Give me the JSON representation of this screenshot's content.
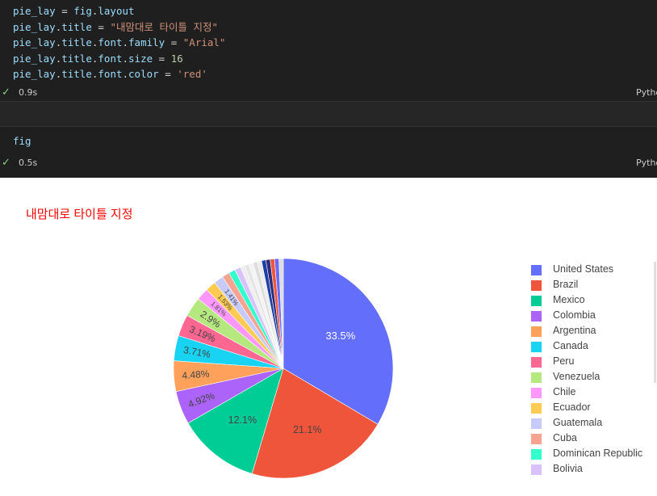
{
  "code_cell": {
    "lines": [
      [
        {
          "t": "pie_lay",
          "c": "v"
        },
        {
          "t": " = ",
          "c": "p"
        },
        {
          "t": "fig",
          "c": "v"
        },
        {
          "t": ".",
          "c": "p"
        },
        {
          "t": "layout",
          "c": "v"
        }
      ],
      [
        {
          "t": "pie_lay",
          "c": "v"
        },
        {
          "t": ".",
          "c": "p"
        },
        {
          "t": "title",
          "c": "v"
        },
        {
          "t": " = ",
          "c": "p"
        },
        {
          "t": "\"내맘대로 타이틀 지정\"",
          "c": "s"
        }
      ],
      [
        {
          "t": "pie_lay",
          "c": "v"
        },
        {
          "t": ".",
          "c": "p"
        },
        {
          "t": "title",
          "c": "v"
        },
        {
          "t": ".",
          "c": "p"
        },
        {
          "t": "font",
          "c": "v"
        },
        {
          "t": ".",
          "c": "p"
        },
        {
          "t": "family",
          "c": "v"
        },
        {
          "t": " = ",
          "c": "p"
        },
        {
          "t": "\"Arial\"",
          "c": "s"
        }
      ],
      [
        {
          "t": "pie_lay",
          "c": "v"
        },
        {
          "t": ".",
          "c": "p"
        },
        {
          "t": "title",
          "c": "v"
        },
        {
          "t": ".",
          "c": "p"
        },
        {
          "t": "font",
          "c": "v"
        },
        {
          "t": ".",
          "c": "p"
        },
        {
          "t": "size",
          "c": "v"
        },
        {
          "t": " = ",
          "c": "p"
        },
        {
          "t": "16",
          "c": "n"
        }
      ],
      [
        {
          "t": "pie_lay",
          "c": "v"
        },
        {
          "t": ".",
          "c": "p"
        },
        {
          "t": "title",
          "c": "v"
        },
        {
          "t": ".",
          "c": "p"
        },
        {
          "t": "font",
          "c": "v"
        },
        {
          "t": ".",
          "c": "p"
        },
        {
          "t": "color",
          "c": "v"
        },
        {
          "t": " = ",
          "c": "p"
        },
        {
          "t": "'red'",
          "c": "s"
        }
      ]
    ],
    "status_time": "0.9s",
    "language": "Python"
  },
  "fig_cell": {
    "code": "fig",
    "status_time": "0.5s",
    "language": "Python"
  },
  "output": {
    "title": "내맘대로 타이틀 지정"
  },
  "chart_data": {
    "type": "pie",
    "title": "내맘대로 타이틀 지정",
    "legend_position": "right",
    "categories": [
      "United States",
      "Brazil",
      "Mexico",
      "Colombia",
      "Argentina",
      "Canada",
      "Peru",
      "Venezuela",
      "Chile",
      "Ecuador",
      "Guatemala",
      "Cuba",
      "Dominican Republic",
      "Bolivia"
    ],
    "values": [
      33.5,
      21.1,
      12.1,
      4.92,
      4.48,
      3.71,
      3.19,
      2.9,
      1.81,
      1.53,
      1.41,
      1.1,
      0.98,
      0.9
    ],
    "labels": [
      "33.5%",
      "21.1%",
      "12.1%",
      "4.92%",
      "4.48%",
      "3.71%",
      "3.19%",
      "2.9%",
      "1.81%",
      "1.53%",
      "1.41%",
      "1.1%",
      "0.98%",
      "0.9%"
    ],
    "colors": [
      "#636efa",
      "#EF553B",
      "#00cc96",
      "#ab63fa",
      "#FFA15A",
      "#19d3f3",
      "#FF6692",
      "#B6E880",
      "#FF97FF",
      "#FECB52",
      "#c6cafe",
      "#f7a391",
      "#33ffcd",
      "#d9c1fc"
    ],
    "other_slice_colors": [
      "#eeeeee",
      "#e5e5e5",
      "#f3f3f3",
      "#dddddd",
      "#ececec",
      "#1f3fa8",
      "#2c2c7a",
      "#ef553b",
      "#6a6aff",
      "#dcdcdc"
    ]
  }
}
